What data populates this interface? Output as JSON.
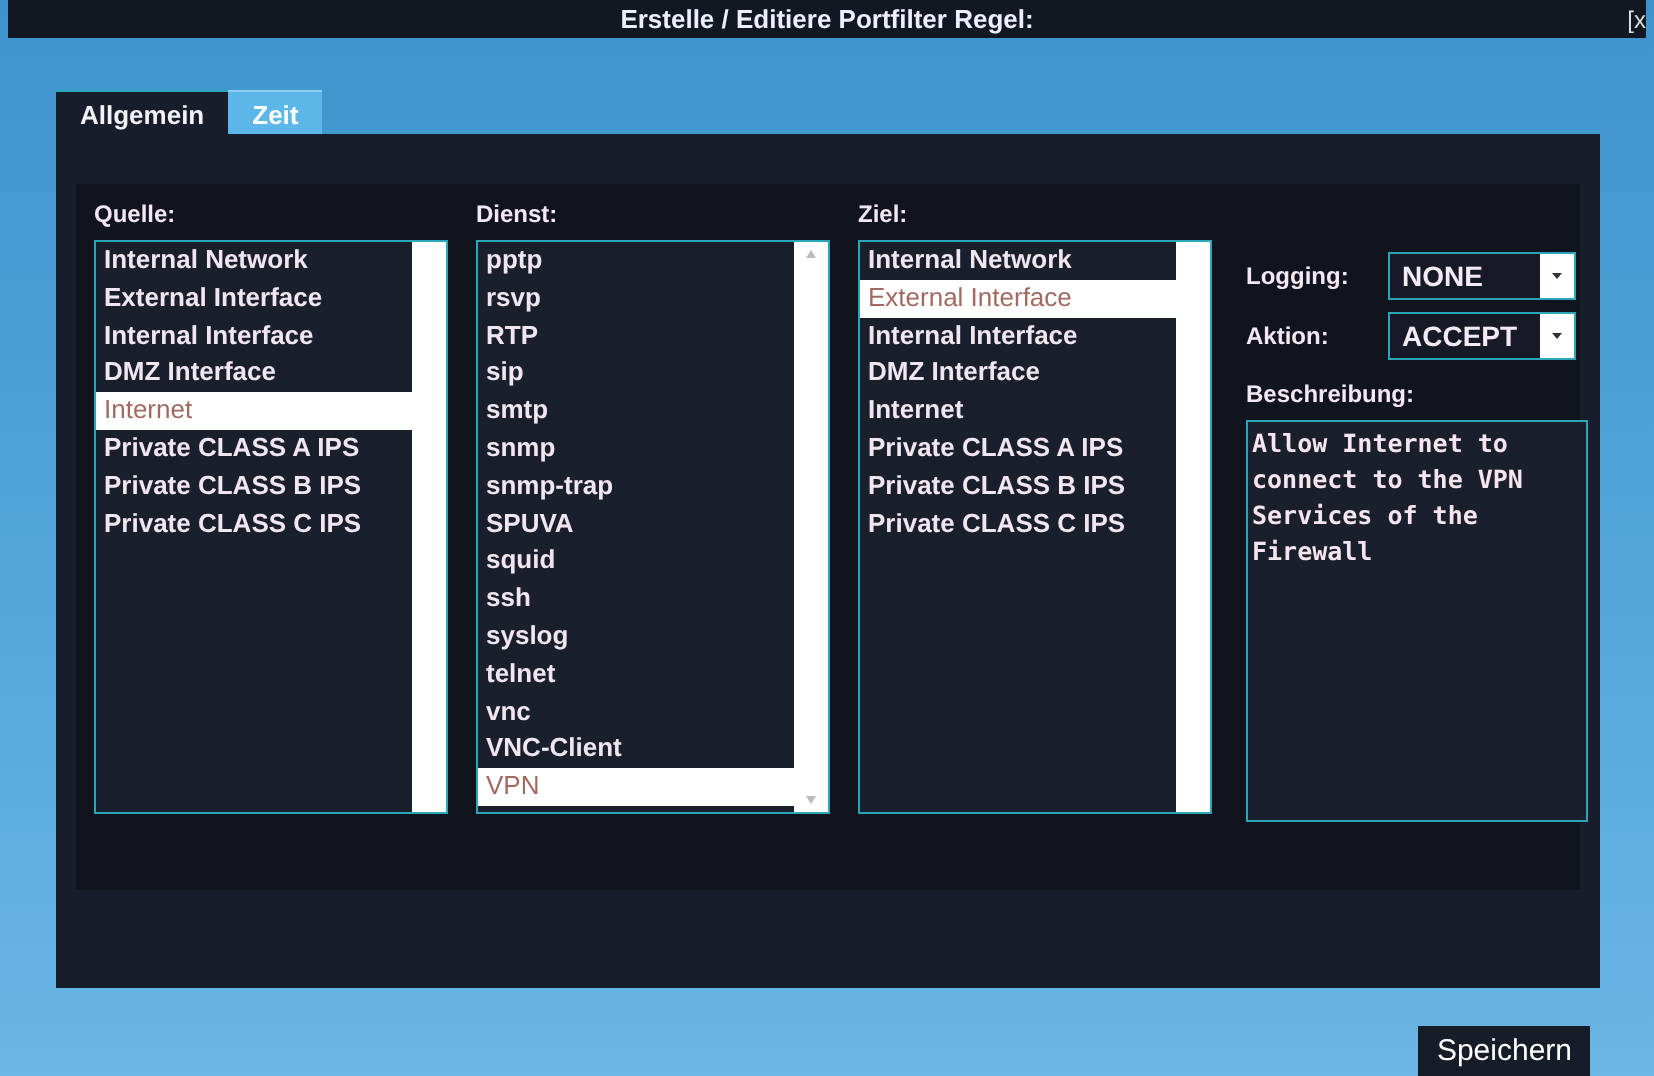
{
  "window": {
    "title": "Erstelle / Editiere Portfilter Regel:",
    "close": "[x"
  },
  "tabs": [
    {
      "label": "Allgemein",
      "selected": true
    },
    {
      "label": "Zeit",
      "selected": false
    }
  ],
  "lists": [
    {
      "label": "Quelle:",
      "scroll_arrows": false,
      "items": [
        {
          "text": "Internal Network",
          "selected": false
        },
        {
          "text": "External Interface",
          "selected": false
        },
        {
          "text": "Internal Interface",
          "selected": false
        },
        {
          "text": "DMZ Interface",
          "selected": false
        },
        {
          "text": "Internet",
          "selected": true
        },
        {
          "text": "Private CLASS A IPS",
          "selected": false
        },
        {
          "text": "Private CLASS B IPS",
          "selected": false
        },
        {
          "text": "Private CLASS C IPS",
          "selected": false
        }
      ]
    },
    {
      "label": "Dienst:",
      "scroll_arrows": true,
      "items": [
        {
          "text": "pptp",
          "selected": false
        },
        {
          "text": "rsvp",
          "selected": false
        },
        {
          "text": "RTP",
          "selected": false
        },
        {
          "text": "sip",
          "selected": false
        },
        {
          "text": "smtp",
          "selected": false
        },
        {
          "text": "snmp",
          "selected": false
        },
        {
          "text": "snmp-trap",
          "selected": false
        },
        {
          "text": "SPUVA",
          "selected": false
        },
        {
          "text": "squid",
          "selected": false
        },
        {
          "text": "ssh",
          "selected": false
        },
        {
          "text": "syslog",
          "selected": false
        },
        {
          "text": "telnet",
          "selected": false
        },
        {
          "text": "vnc",
          "selected": false
        },
        {
          "text": "VNC-Client",
          "selected": false
        },
        {
          "text": "VPN",
          "selected": true
        }
      ]
    },
    {
      "label": "Ziel:",
      "scroll_arrows": false,
      "items": [
        {
          "text": "Internal Network",
          "selected": false
        },
        {
          "text": "External Interface",
          "selected": true
        },
        {
          "text": "Internal Interface",
          "selected": false
        },
        {
          "text": "DMZ Interface",
          "selected": false
        },
        {
          "text": "Internet",
          "selected": false
        },
        {
          "text": "Private CLASS A IPS",
          "selected": false
        },
        {
          "text": "Private CLASS B IPS",
          "selected": false
        },
        {
          "text": "Private CLASS C IPS",
          "selected": false
        }
      ]
    }
  ],
  "selects": [
    {
      "label": "Logging:",
      "value": "NONE"
    },
    {
      "label": "Aktion:",
      "value": "ACCEPT"
    }
  ],
  "description": {
    "label": "Beschreibung:",
    "value": "Allow Internet to\nconnect to the VPN\nServices of the\nFirewall"
  },
  "buttons": [
    "Speichern"
  ]
}
